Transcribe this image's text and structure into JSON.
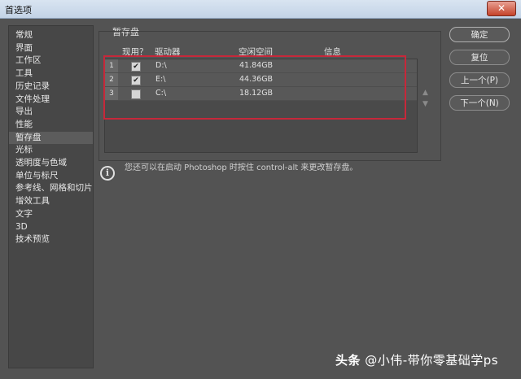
{
  "window": {
    "title": "首选项",
    "close_label": "✕"
  },
  "sidebar": {
    "items": [
      "常规",
      "界面",
      "工作区",
      "工具",
      "历史记录",
      "文件处理",
      "导出",
      "性能",
      "暂存盘",
      "光标",
      "透明度与色域",
      "单位与标尺",
      "参考线、网格和切片",
      "增效工具",
      "文字",
      "3D",
      "技术预览"
    ],
    "active_index": 8
  },
  "scratch": {
    "group_title": "暂存盘",
    "columns": {
      "active": "现用？",
      "drive": "驱动器",
      "free_space": "空闲空间",
      "info": "信息"
    },
    "rows": [
      {
        "num": "1",
        "checked": true,
        "drive": "D:\\",
        "free": "41.84GB",
        "info": ""
      },
      {
        "num": "2",
        "checked": true,
        "drive": "E:\\",
        "free": "44.36GB",
        "info": ""
      },
      {
        "num": "3",
        "checked": false,
        "drive": "C:\\",
        "free": "18.12GB",
        "info": ""
      }
    ],
    "up_arrow": "▲",
    "down_arrow": "▼"
  },
  "info": {
    "icon": "i",
    "text": "您还可以在启动 Photoshop 时按住 control-alt 来更改暂存盘。"
  },
  "buttons": {
    "ok": "确定",
    "reset": "复位",
    "prev": "上一个(P)",
    "next": "下一个(N)"
  },
  "watermark": {
    "logo": "头条",
    "text": "@小伟-带你零基础学ps"
  },
  "colors": {
    "highlight_box": "#c7283a",
    "dialog_bg": "#535353"
  }
}
